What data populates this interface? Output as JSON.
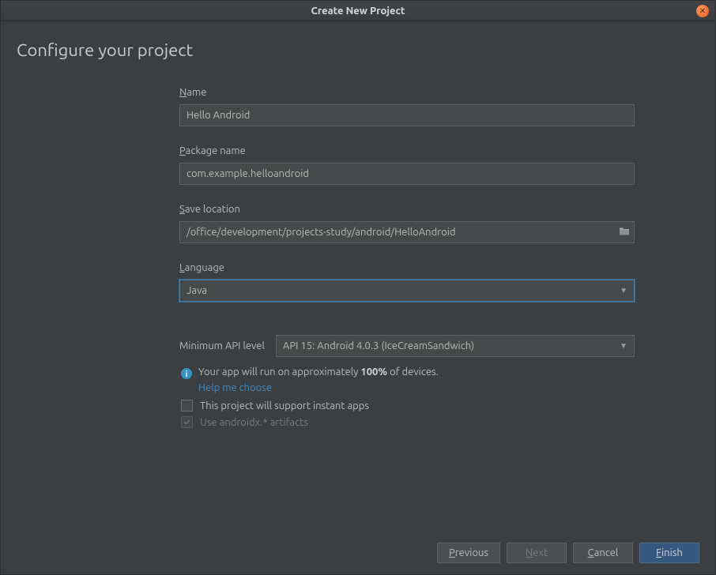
{
  "window": {
    "title": "Create New Project"
  },
  "heading": "Configure your project",
  "fields": {
    "name": {
      "label": "Name",
      "mnemonic": "N",
      "rest": "ame",
      "value": "Hello Android"
    },
    "package": {
      "label": "Package name",
      "mnemonic": "P",
      "rest": "ackage name",
      "value": "com.example.helloandroid"
    },
    "location": {
      "label": "Save location",
      "mnemonic": "S",
      "rest": "ave location",
      "value": "/office/development/projects-study/android/HelloAndroid"
    },
    "language": {
      "label": "Language",
      "mnemonic": "L",
      "rest": "anguage",
      "value": "Java"
    }
  },
  "api": {
    "label": "Minimum API level",
    "value": "API 15: Android 4.0.3 (IceCreamSandwich)"
  },
  "info": {
    "prefix": "Your app will run on approximately ",
    "percent": "100%",
    "suffix": " of devices.",
    "help": "Help me choose"
  },
  "checkboxes": {
    "instant": {
      "label": "This project will support instant apps",
      "checked": false,
      "enabled": true
    },
    "androidx": {
      "label": "Use androidx.* artifacts",
      "checked": true,
      "enabled": false
    }
  },
  "buttons": {
    "previous": {
      "label": "Previous",
      "mnemonic": "P",
      "rest": "revious"
    },
    "next": {
      "label": "Next",
      "mnemonic": "N",
      "rest": "ext"
    },
    "cancel": {
      "label": "Cancel",
      "mnemonic": "C",
      "rest": "ancel"
    },
    "finish": {
      "label": "Finish",
      "mnemonic": "F",
      "rest": "inish"
    }
  }
}
